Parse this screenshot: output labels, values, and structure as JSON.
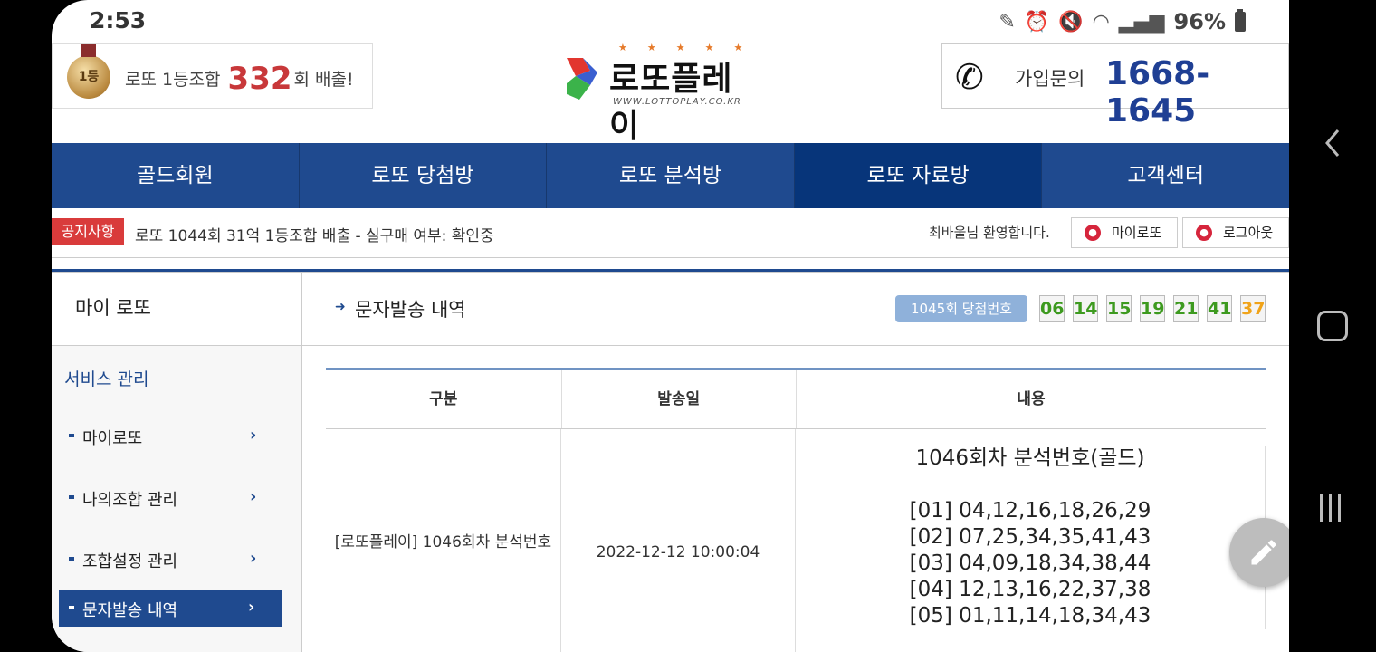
{
  "status_bar": {
    "time": "2:53",
    "battery": "96%"
  },
  "promo": {
    "medal_text": "1등",
    "prefix": "로또 1등조합",
    "count": "332",
    "suffix": "회 배출!"
  },
  "logo": {
    "title": "로또플레이",
    "url": "WWW.LOTTOPLAY.CO.KR",
    "stars": "★★★★★"
  },
  "contact": {
    "label": "가입문의",
    "phone": "1668-1645"
  },
  "nav": {
    "items": [
      {
        "label": "골드회원"
      },
      {
        "label": "로또 당첨방"
      },
      {
        "label": "로또 분석방"
      },
      {
        "label": "로또 자료방"
      },
      {
        "label": "고객센터"
      }
    ]
  },
  "notice": {
    "badge": "공지사항",
    "text": "로또 1044회 31억 1등조합 배출 - 실구매 여부: 확인중",
    "welcome": "최바울님 환영합니다.",
    "my_lotto_btn": "마이로또",
    "logout_btn": "로그아웃"
  },
  "sidebar": {
    "title": "마이 로또",
    "section": "서비스 관리",
    "items": [
      {
        "label": "마이로또"
      },
      {
        "label": "나의조합 관리"
      },
      {
        "label": "조합설정 관리"
      },
      {
        "label": "문자발송 내역"
      }
    ]
  },
  "main": {
    "title": "문자발송 내역",
    "draw_badge": "1045회 당첨번호",
    "balls": [
      "06",
      "14",
      "15",
      "19",
      "21",
      "41",
      "37"
    ],
    "table": {
      "headers": [
        "구분",
        "발송일",
        "내용"
      ],
      "rows": [
        {
          "type": "[로또플레이] 1046회차 분석번호",
          "date": "2022-12-12 10:00:04",
          "content_title": "1046회차 분석번호(골드)",
          "content_lines": [
            "[01] 04,12,16,18,26,29",
            "[02] 07,25,34,35,41,43",
            "[03] 04,09,18,34,38,44",
            "[04] 12,13,16,22,37,38",
            "[05] 01,11,14,18,34,43"
          ]
        }
      ]
    }
  }
}
